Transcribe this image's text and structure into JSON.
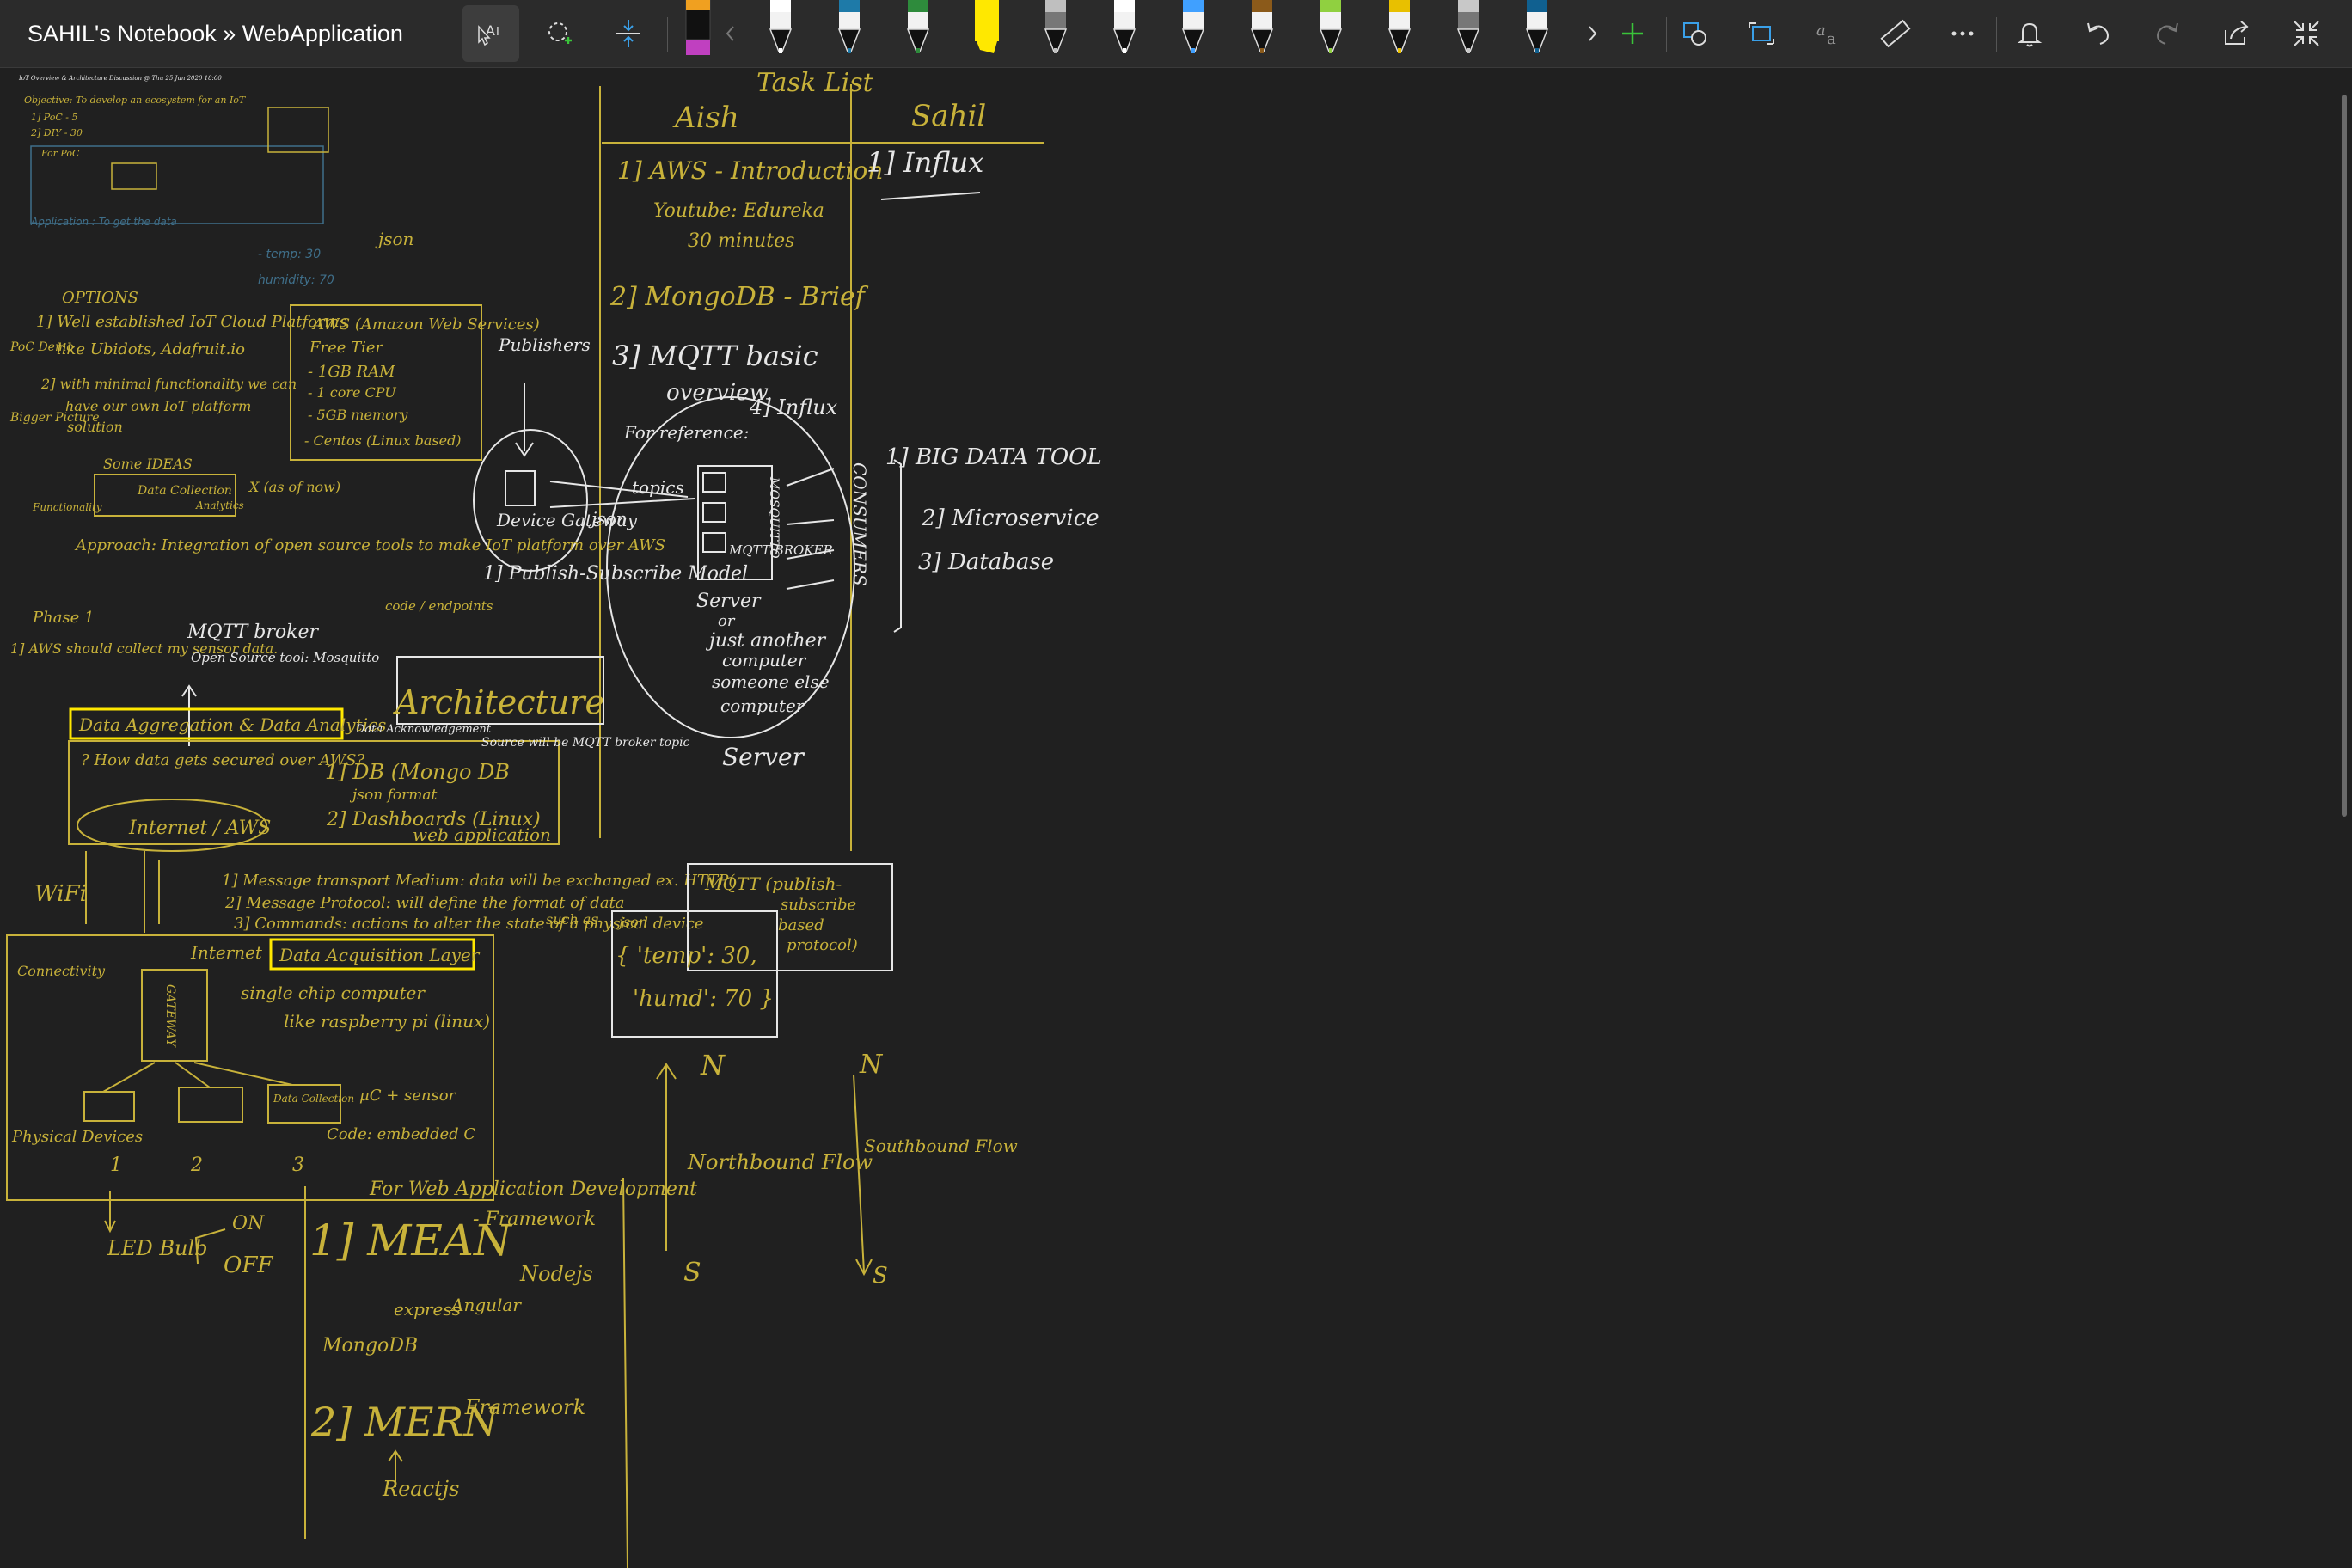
{
  "app": {
    "title": "SAHIL's Notebook » WebApplication"
  },
  "toolbar": {
    "tools": [
      {
        "name": "ink-to-text",
        "icon": "ink-to-text-icon",
        "active": true
      },
      {
        "name": "lasso-select",
        "icon": "lasso-select-icon"
      },
      {
        "name": "add-space",
        "icon": "add-space-icon"
      }
    ],
    "pens": [
      {
        "color": "#c040c0",
        "type": "marker"
      },
      {
        "color": "#ffffff",
        "type": "pen"
      },
      {
        "color": "#1e7aa8",
        "type": "pen"
      },
      {
        "color": "#2e8b3c",
        "type": "pen"
      },
      {
        "color": "#ffe800",
        "type": "highlighter"
      },
      {
        "color": "#bfbfbf",
        "type": "pencil"
      },
      {
        "color": "#ffffff",
        "type": "pen"
      },
      {
        "color": "#40a0ff",
        "type": "galaxy"
      },
      {
        "color": "#8b5a1a",
        "type": "pen"
      },
      {
        "color": "#90d040",
        "type": "pen"
      },
      {
        "color": "#e8c000",
        "type": "pen"
      },
      {
        "color": "#c8c8c8",
        "type": "pencil"
      },
      {
        "color": "#106090",
        "type": "pen"
      }
    ],
    "right_tools": [
      "shapes-icon",
      "convert-icon",
      "math-icon",
      "ruler-icon",
      "more-icon",
      "notification-icon",
      "undo-icon",
      "redo-icon",
      "share-icon",
      "collapse-icon"
    ]
  },
  "notes": {
    "task_list": {
      "heading": "Task List",
      "col1": "Aish",
      "col2": "Sahil",
      "aish_items": [
        "1] AWS - Introduction",
        "Youtube: Edureka",
        "30 minutes",
        "2] MongoDB - Brief",
        "3] MQTT basic",
        "overview.",
        "4] Influx",
        "For reference:"
      ],
      "sahil_items": [
        "1] Influx"
      ]
    },
    "mqtt_diagram": {
      "publishers": "Publishers",
      "gateway": "Device Gateway",
      "json": "json",
      "topics": "topics",
      "model": "1] Publish-Subscribe Model",
      "broker": "MQTT BROKER",
      "mosquitto_vertical": "MOSQUITTO",
      "server_text": [
        "Server",
        "or",
        "just another",
        "computer",
        "someone else",
        "computer"
      ],
      "server_label": "Server",
      "consumers": "CONSUMERS",
      "consumer_items": [
        "1] BIG DATA TOOL",
        "2] Microservice",
        "3] Database"
      ]
    },
    "top_left_small": {
      "lines": [
        "IoT Overview & Architecture Discussion @ Thu 25 Jun 2020 18:00",
        "Objective: To develop an ecosystem for an IoT",
        "1] PoC - 5",
        "2] DIY - 30",
        "For PoC",
        "Application : To get the data",
        "- temp: 30",
        "humidity: 70",
        "json"
      ]
    },
    "options": {
      "heading": "OPTIONS",
      "items": [
        "1] Well established IoT Cloud Platforms",
        "like Ubidots, Adafruit.io",
        "2] with minimal functionality we can",
        "have our own IoT platform",
        "solution",
        "Some IDEAS",
        "Data Collection",
        "Analytics",
        "X (as of now)"
      ],
      "side_labels": [
        "PoC Demo",
        "Bigger Picture",
        "Functionality"
      ],
      "aws_box": [
        "AWS (Amazon Web Services)",
        "Free Tier",
        "- 1GB RAM",
        "- 1 core CPU",
        "- 5GB memory",
        "- Centos (Linux based)"
      ]
    },
    "approach": {
      "text": "Approach: Integration of open source tools to make IoT platform over AWS",
      "code": "code / endpoints",
      "phase": "Phase 1",
      "phase_text": "1] AWS should collect my sensor data.",
      "mqtt_broker": "MQTT broker",
      "open_source": "Open Source tool: Mosquitto"
    },
    "architecture": {
      "heading": "Architecture",
      "analytics": "Data Aggregation & Data Analytics",
      "data_ack": "Data Acknowledgement",
      "question": "? How data gets secured over AWS?",
      "internet": "Internet / AWS",
      "db": "1] DB (Mongo DB",
      "json_format": "json format",
      "dash": "2] Dashboards (Linux)",
      "webapp": "web application",
      "source": "Source will be MQTT broker topic",
      "wifi": "WiFi",
      "message_points": [
        "1] Message transport Medium: data will be exchanged ex. HTTP(",
        "2] Message Protocol: will define the format of data",
        "3] Commands: actions to alter the state of a physical device"
      ],
      "such_as": "such as",
      "mqtt_box": [
        "MQTT (publish-",
        "subscribe",
        "based",
        "protocol)"
      ],
      "json_box": [
        "json",
        "{ 'temp': 30,",
        "'humd': 70 }"
      ],
      "connectivity": "Connectivity",
      "internet_label": "Internet",
      "acq_layer": "Data Acquisition Layer",
      "gateway_v": "GATEWAY",
      "sbc": "single chip computer",
      "raspberry": "like raspberry pi (linux)",
      "data_collection": "Data Collection",
      "mc_sensor": "µC + sensor",
      "code_c": "Code: embedded C",
      "physical": "Physical Devices",
      "numbers": [
        "1",
        "2",
        "3"
      ],
      "led": "LED Bulb",
      "on": "ON",
      "off": "OFF"
    },
    "flows": {
      "north": "N",
      "south": "S",
      "northbound": "Northbound Flow",
      "southbound": "Southbound Flow"
    },
    "webdev": {
      "heading": "For Web Application Development",
      "mean": "1] MEAN",
      "framework": "- Framework",
      "nodejs": "Nodejs",
      "express": "express",
      "angular": "Angular",
      "mongodb": "MongoDB",
      "mern": "2] MERN",
      "framework2": "- Framework",
      "reactjs": "Reactjs"
    }
  }
}
